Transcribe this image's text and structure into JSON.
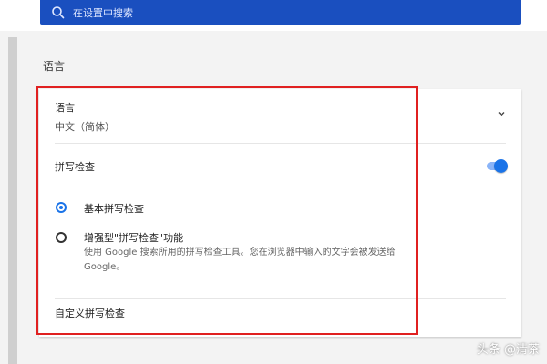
{
  "search": {
    "placeholder": "在设置中搜索"
  },
  "section": {
    "title": "语言"
  },
  "language": {
    "label": "语言",
    "value": "中文（简体）"
  },
  "spellcheck": {
    "label": "拼写检查",
    "enabled": true,
    "options": [
      {
        "label": "基本拼写检查",
        "checked": true,
        "desc": ""
      },
      {
        "label": "增强型\"拼写检查\"功能",
        "checked": false,
        "desc": "使用 Google 搜索所用的拼写检查工具。您在浏览器中输入的文字会被发送给 Google。"
      }
    ],
    "custom_label": "自定义拼写检查"
  },
  "watermark": "头条 @清茶",
  "colors": {
    "accent": "#1a73e8",
    "search_bar": "#1a4fbf",
    "highlight_frame": "#e02020"
  }
}
